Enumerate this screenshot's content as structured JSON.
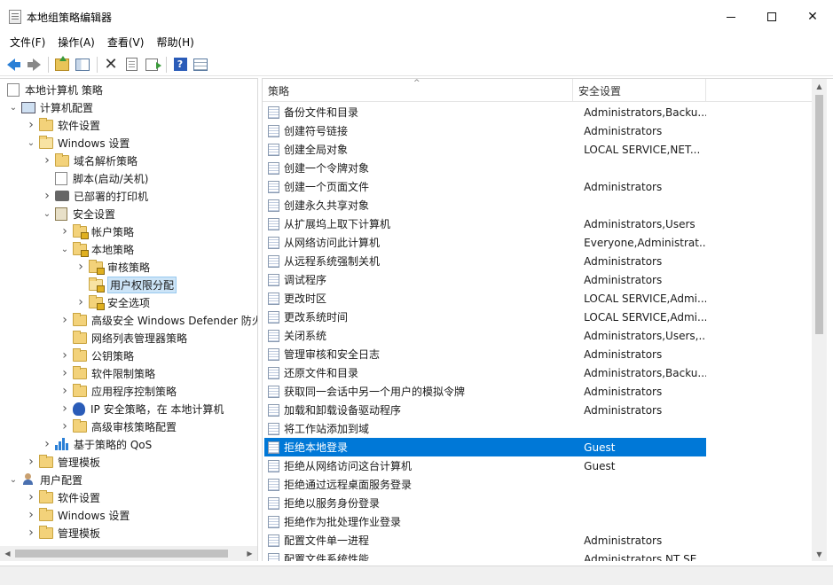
{
  "window": {
    "title": "本地组策略编辑器",
    "icon": "policy-editor-icon",
    "controls": {
      "minimize": "",
      "maximize": "",
      "close": "✕"
    }
  },
  "menu": [
    {
      "label": "文件(F)"
    },
    {
      "label": "操作(A)"
    },
    {
      "label": "查看(V)"
    },
    {
      "label": "帮助(H)"
    }
  ],
  "toolbar": {
    "buttons": [
      "back-icon",
      "forward-icon",
      "up-folder-icon",
      "show-hide-tree-icon",
      "delete-icon",
      "properties-icon",
      "export-list-icon",
      "help-icon",
      "view-icon"
    ]
  },
  "tree": {
    "items": [
      {
        "label": "本地计算机 策略",
        "level": 0,
        "expander": "",
        "icon": "policy-icon"
      },
      {
        "label": "计算机配置",
        "level": 1,
        "expander": "expanded",
        "icon": "computer-icon"
      },
      {
        "label": "软件设置",
        "level": 2,
        "expander": "collapsed",
        "icon": "folder-icon"
      },
      {
        "label": "Windows 设置",
        "level": 2,
        "expander": "expanded",
        "icon": "folder-icon"
      },
      {
        "label": "域名解析策略",
        "level": 3,
        "expander": "collapsed",
        "icon": "folder-icon"
      },
      {
        "label": "脚本(启动/关机)",
        "level": 3,
        "expander": "",
        "icon": "script-icon"
      },
      {
        "label": "已部署的打印机",
        "level": 3,
        "expander": "collapsed",
        "icon": "printer-icon"
      },
      {
        "label": "安全设置",
        "level": 3,
        "expander": "expanded",
        "icon": "security-settings-icon"
      },
      {
        "label": "帐户策略",
        "level": 4,
        "expander": "collapsed",
        "icon": "locked-folder-icon"
      },
      {
        "label": "本地策略",
        "level": 4,
        "expander": "expanded",
        "icon": "locked-folder-icon"
      },
      {
        "label": "审核策略",
        "level": 5,
        "expander": "collapsed",
        "icon": "locked-folder-icon"
      },
      {
        "label": "用户权限分配",
        "level": 5,
        "expander": "",
        "icon": "locked-folder-open-icon",
        "selected": true
      },
      {
        "label": "安全选项",
        "level": 5,
        "expander": "collapsed",
        "icon": "locked-folder-icon"
      },
      {
        "label": "高级安全 Windows Defender 防火",
        "level": 4,
        "expander": "collapsed",
        "icon": "folder-icon"
      },
      {
        "label": "网络列表管理器策略",
        "level": 4,
        "expander": "",
        "icon": "folder-icon"
      },
      {
        "label": "公钥策略",
        "level": 4,
        "expander": "collapsed",
        "icon": "folder-icon"
      },
      {
        "label": "软件限制策略",
        "level": 4,
        "expander": "collapsed",
        "icon": "folder-icon"
      },
      {
        "label": "应用程序控制策略",
        "level": 4,
        "expander": "collapsed",
        "icon": "folder-icon"
      },
      {
        "label": "IP 安全策略，在 本地计算机",
        "level": 4,
        "expander": "collapsed",
        "icon": "ip-security-icon"
      },
      {
        "label": "高级审核策略配置",
        "level": 4,
        "expander": "collapsed",
        "icon": "folder-icon"
      },
      {
        "label": "基于策略的 QoS",
        "level": 3,
        "expander": "collapsed",
        "icon": "qos-chart-icon"
      },
      {
        "label": "管理模板",
        "level": 2,
        "expander": "collapsed",
        "icon": "folder-icon"
      },
      {
        "label": "用户配置",
        "level": 1,
        "expander": "expanded",
        "icon": "user-icon"
      },
      {
        "label": "软件设置",
        "level": 2,
        "expander": "collapsed",
        "icon": "folder-icon"
      },
      {
        "label": "Windows 设置",
        "level": 2,
        "expander": "collapsed",
        "icon": "folder-icon"
      },
      {
        "label": "管理模板",
        "level": 2,
        "expander": "collapsed",
        "icon": "folder-icon"
      }
    ]
  },
  "list": {
    "columns": {
      "policy": "策略",
      "setting": "安全设置",
      "sort_indicator": "^"
    },
    "rows": [
      {
        "name": "备份文件和目录",
        "value": "Administrators,Backu..."
      },
      {
        "name": "创建符号链接",
        "value": "Administrators"
      },
      {
        "name": "创建全局对象",
        "value": "LOCAL SERVICE,NET..."
      },
      {
        "name": "创建一个令牌对象",
        "value": ""
      },
      {
        "name": "创建一个页面文件",
        "value": "Administrators"
      },
      {
        "name": "创建永久共享对象",
        "value": ""
      },
      {
        "name": "从扩展坞上取下计算机",
        "value": "Administrators,Users"
      },
      {
        "name": "从网络访问此计算机",
        "value": "Everyone,Administrat..."
      },
      {
        "name": "从远程系统强制关机",
        "value": "Administrators"
      },
      {
        "name": "调试程序",
        "value": "Administrators"
      },
      {
        "name": "更改时区",
        "value": "LOCAL SERVICE,Admi..."
      },
      {
        "name": "更改系统时间",
        "value": "LOCAL SERVICE,Admi..."
      },
      {
        "name": "关闭系统",
        "value": "Administrators,Users,..."
      },
      {
        "name": "管理审核和安全日志",
        "value": "Administrators"
      },
      {
        "name": "还原文件和目录",
        "value": "Administrators,Backu..."
      },
      {
        "name": "获取同一会话中另一个用户的模拟令牌",
        "value": "Administrators"
      },
      {
        "name": "加载和卸载设备驱动程序",
        "value": "Administrators"
      },
      {
        "name": "将工作站添加到域",
        "value": ""
      },
      {
        "name": "拒绝本地登录",
        "value": "Guest",
        "selected": true
      },
      {
        "name": "拒绝从网络访问这台计算机",
        "value": "Guest"
      },
      {
        "name": "拒绝通过远程桌面服务登录",
        "value": ""
      },
      {
        "name": "拒绝以服务身份登录",
        "value": ""
      },
      {
        "name": "拒绝作为批处理作业登录",
        "value": ""
      },
      {
        "name": "配置文件单一进程",
        "value": "Administrators"
      },
      {
        "name": "配置文件系统性能",
        "value": "Administrators,NT SE..."
      }
    ]
  },
  "colors": {
    "selection": "#0078d7",
    "tree_selection": "#cce4f7",
    "folder": "#f3d27a"
  }
}
